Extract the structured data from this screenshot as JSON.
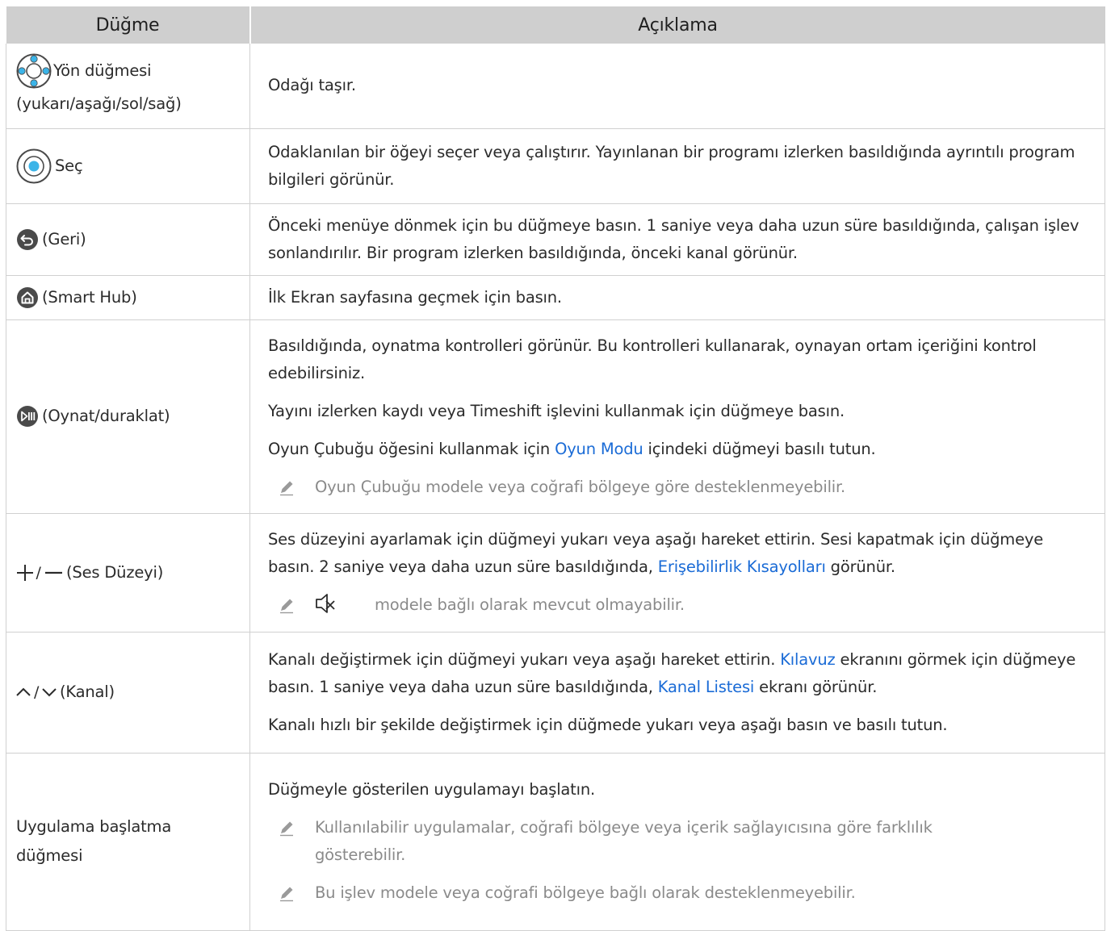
{
  "header": {
    "col1": "Düğme",
    "col2": "Açıklama"
  },
  "rows": [
    {
      "button_line1": "Yön düğmesi",
      "button_line2": "(yukarı/aşağı/sol/sağ)",
      "desc": "Odağı taşır."
    },
    {
      "button": "Seç",
      "desc": "Odaklanılan bir öğeyi seçer veya çalıştırır. Yayınlanan bir programı izlerken basıldığında ayrıntılı program bilgileri görünür."
    },
    {
      "button": "(Geri)",
      "desc": "Önceki menüye dönmek için bu düğmeye basın. 1 saniye veya daha uzun süre basıldığında, çalışan işlev sonlandırılır. Bir program izlerken basıldığında, önceki kanal görünür."
    },
    {
      "button": "(Smart Hub)",
      "desc": "İlk Ekran sayfasına geçmek için basın."
    },
    {
      "button": "(Oynat/duraklat)",
      "p1": "Basıldığında, oynatma kontrolleri görünür. Bu kontrolleri kullanarak, oynayan ortam içeriğini kontrol edebilirsiniz.",
      "p2": "Yayını izlerken kaydı veya Timeshift işlevini kullanmak için düğmeye basın.",
      "p3_before": "Oyun Çubuğu öğesini kullanmak için ",
      "p3_link": "Oyun Modu",
      "p3_after": " içindeki düğmeyi basılı tutun.",
      "note": "Oyun Çubuğu modele veya coğrafi bölgeye göre desteklenmeyebilir."
    },
    {
      "button": "(Ses Düzeyi)",
      "button_symbols": "+/−",
      "p1_before": "Ses düzeyini ayarlamak için düğmeyi yukarı veya aşağı hareket ettirin. Sesi kapatmak için düğmeye basın. 2 saniye veya daha uzun süre basıldığında, ",
      "p1_link": "Erişebilirlik Kısayolları",
      "p1_after": " görünür.",
      "note": "modele bağlı olarak mevcut olmayabilir."
    },
    {
      "button": "(Kanal)",
      "p1_a": "Kanalı değiştirmek için düğmeyi yukarı veya aşağı hareket ettirin. ",
      "p1_link1": "Kılavuz",
      "p1_b": " ekranını görmek için düğmeye basın. 1 saniye veya daha uzun süre basıldığında, ",
      "p1_link2": "Kanal Listesi",
      "p1_c": " ekranı görünür.",
      "p2": "Kanalı hızlı bir şekilde değiştirmek için düğmede yukarı veya aşağı basın ve basılı tutun."
    },
    {
      "button": "Uygulama başlatma düğmesi",
      "p1": "Düğmeyle gösterilen uygulamayı başlatın.",
      "note1": "Kullanılabilir uygulamalar, coğrafi bölgeye veya içerik sağlayıcısına göre farklılık gösterebilir.",
      "note2": "Bu işlev modele veya coğrafi bölgeye bağlı olarak desteklenmeyebilir."
    }
  ],
  "colors": {
    "header_bg": "#cfcfcf",
    "link": "#1a6bd6",
    "note": "#8a8a8a",
    "icon_dark": "#4a4a4a",
    "icon_blue": "#3bb4e8"
  }
}
